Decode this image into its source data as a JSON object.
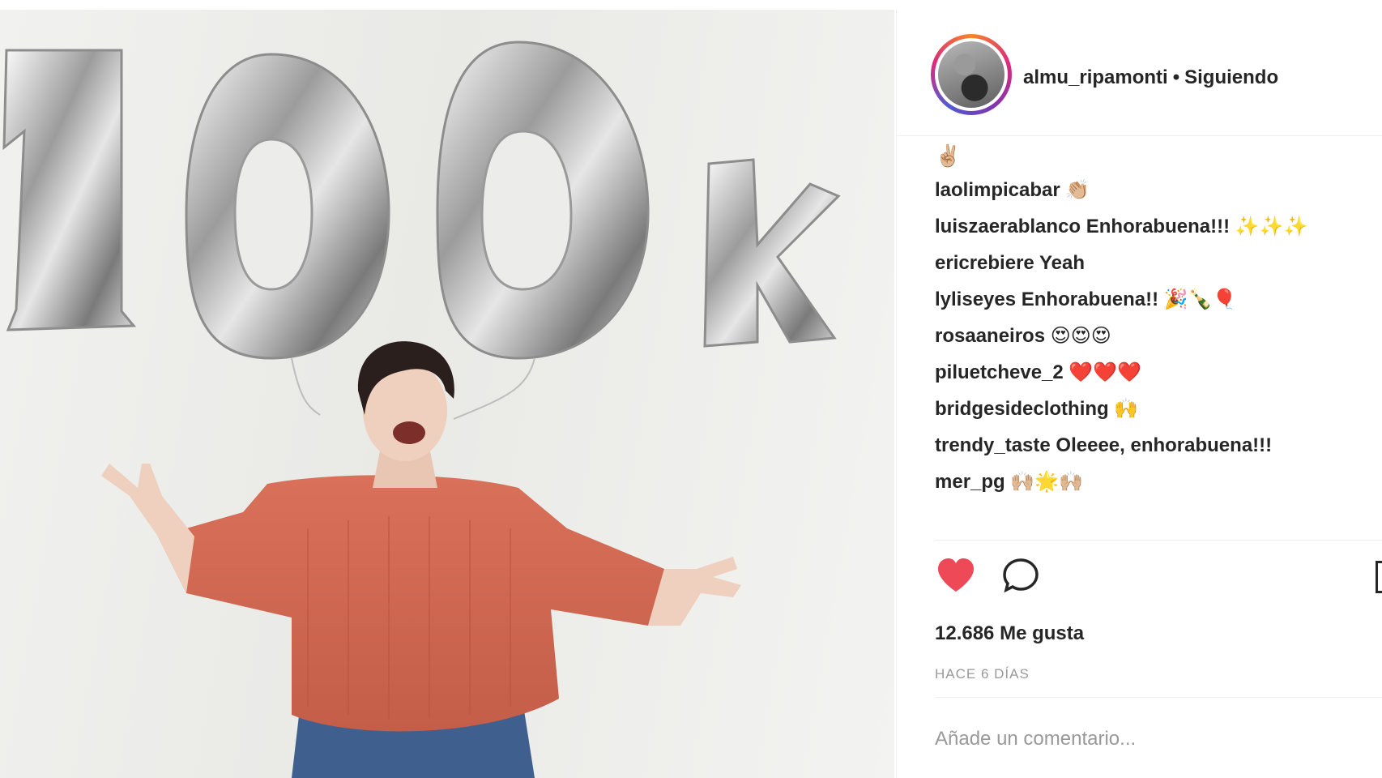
{
  "post": {
    "username": "almu_ripamonti",
    "separator": "•",
    "follow_status": "Siguiendo",
    "caption_emoji": "✌🏼",
    "comments": [
      {
        "user": "laolimpicabar",
        "text": "",
        "emoji": "👏🏼"
      },
      {
        "user": "luiszaerablanco",
        "text": "Enhorabuena!!!",
        "emoji": "✨✨✨"
      },
      {
        "user": "ericrebiere",
        "text": "Yeah",
        "emoji": ""
      },
      {
        "user": "lyliseyes",
        "text": "Enhorabuena!!",
        "emoji": "🎉🍾🎈"
      },
      {
        "user": "rosaaneiros",
        "text": "",
        "emoji": "😍😍😍"
      },
      {
        "user": "piluetcheve_2",
        "text": "",
        "emoji": "❤️❤️❤️"
      },
      {
        "user": "bridgesideclothing",
        "text": "",
        "emoji": "🙌"
      },
      {
        "user": "trendy_taste",
        "text": "Oleeee, enhorabuena!!!",
        "emoji": ""
      },
      {
        "user": "mer_pg",
        "text": "",
        "emoji": "🙌🏼🌟🙌🏼"
      }
    ],
    "likes_label": "12.686 Me gusta",
    "time_label": "HACE 6 DÍAS",
    "add_comment_placeholder": "Añade un comentario...",
    "icons": {
      "like": "heart-icon",
      "comment": "comment-bubble-icon",
      "save": "bookmark-icon"
    },
    "colors": {
      "liked_heart": "#ed4956",
      "text": "#262626",
      "muted": "#999999"
    }
  },
  "photo": {
    "balloon_text": [
      "1",
      "0",
      "0",
      "k"
    ]
  }
}
